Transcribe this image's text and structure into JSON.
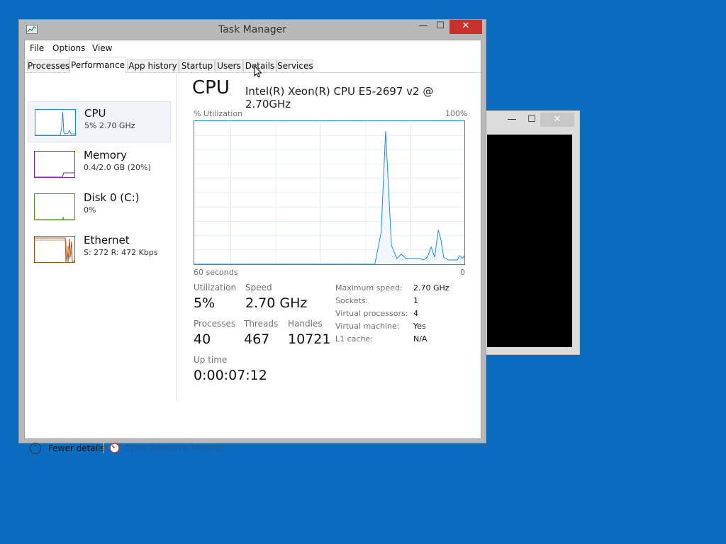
{
  "window": {
    "title": "Task Manager",
    "controls": {
      "minimize": "—",
      "maximize": "☐",
      "close": "✕"
    }
  },
  "back_window": {
    "controls": {
      "minimize": "—",
      "maximize": "☐",
      "close": "✕"
    }
  },
  "menu": [
    "File",
    "Options",
    "View"
  ],
  "tabs": [
    "Processes",
    "Performance",
    "App history",
    "Startup",
    "Users",
    "Details",
    "Services"
  ],
  "active_tab": "Performance",
  "resources": [
    {
      "name": "CPU",
      "sub": "5% 2.70 GHz",
      "color": "#1b8ed6",
      "selected": true
    },
    {
      "name": "Memory",
      "sub": "0.4/2.0 GB (20%)",
      "color": "#8b1fa9",
      "selected": false
    },
    {
      "name": "Disk 0 (C:)",
      "sub": "0%",
      "color": "#4d9a1a",
      "selected": false
    },
    {
      "name": "Ethernet",
      "sub": "S: 272  R: 472 Kbps",
      "color": "#a8501b",
      "selected": false
    }
  ],
  "cpu": {
    "title": "CPU",
    "model": "Intel(R) Xeon(R) CPU E5-2697 v2 @ 2.70GHz",
    "graph": {
      "ylabel": "% Utilization",
      "ymax_label": "100%",
      "xleft_label": "60 seconds",
      "xright_label": "0"
    },
    "stats": {
      "utilization_label": "Utilization",
      "utilization": "5%",
      "speed_label": "Speed",
      "speed": "2.70 GHz",
      "processes_label": "Processes",
      "processes": "40",
      "threads_label": "Threads",
      "threads": "467",
      "handles_label": "Handles",
      "handles": "10721",
      "uptime_label": "Up time",
      "uptime": "0:00:07:12"
    },
    "details": [
      {
        "key": "Maximum speed:",
        "value": "2.70 GHz"
      },
      {
        "key": "Sockets:",
        "value": "1"
      },
      {
        "key": "Virtual processors:",
        "value": "4"
      },
      {
        "key": "Virtual machine:",
        "value": "Yes"
      },
      {
        "key": "L1 cache:",
        "value": "N/A"
      }
    ]
  },
  "footer": {
    "fewer_details": "Fewer details",
    "open_resource_monitor": "Open Resource Monitor"
  },
  "colors": {
    "desktop": "#0a6cbf",
    "cpu_accent": "#1b8ed6",
    "close_button": "#c7312a",
    "link": "#1e5aa8"
  },
  "chart_data": {
    "type": "line",
    "title": "",
    "xlabel": "",
    "ylabel": "% Utilization",
    "xlim": [
      60,
      0
    ],
    "ylim": [
      0,
      100
    ],
    "grid": true,
    "series": [
      {
        "values": [
          [
            60,
            0
          ],
          [
            59,
            0
          ],
          [
            58,
            0
          ],
          [
            57,
            0
          ],
          [
            56,
            0
          ],
          [
            55,
            0
          ],
          [
            54,
            0
          ],
          [
            53,
            0
          ],
          [
            52,
            0
          ],
          [
            51,
            0
          ],
          [
            50,
            0
          ],
          [
            48,
            0
          ],
          [
            46,
            0
          ],
          [
            44,
            0
          ],
          [
            42,
            0
          ],
          [
            40,
            0
          ],
          [
            38,
            0
          ],
          [
            36,
            0
          ],
          [
            34,
            0
          ],
          [
            32,
            0
          ],
          [
            30,
            0
          ],
          [
            28,
            0
          ],
          [
            26,
            0
          ],
          [
            24,
            0
          ],
          [
            22,
            0
          ],
          [
            20,
            0
          ],
          [
            19.9,
            0
          ],
          [
            18.5,
            22
          ],
          [
            17.5,
            93
          ],
          [
            16.2,
            13
          ],
          [
            15,
            4
          ],
          [
            14,
            7
          ],
          [
            13,
            4
          ],
          [
            11.5,
            4
          ],
          [
            10,
            4
          ],
          [
            9,
            3
          ],
          [
            8.2,
            5
          ],
          [
            7.4,
            12
          ],
          [
            6.6,
            5
          ],
          [
            5.8,
            24
          ],
          [
            5.2,
            17
          ],
          [
            4.6,
            5
          ],
          [
            3.6,
            3
          ],
          [
            2.6,
            3
          ],
          [
            1.6,
            3
          ],
          [
            1,
            6
          ],
          [
            0.5,
            4
          ],
          [
            0,
            6
          ]
        ]
      }
    ]
  }
}
